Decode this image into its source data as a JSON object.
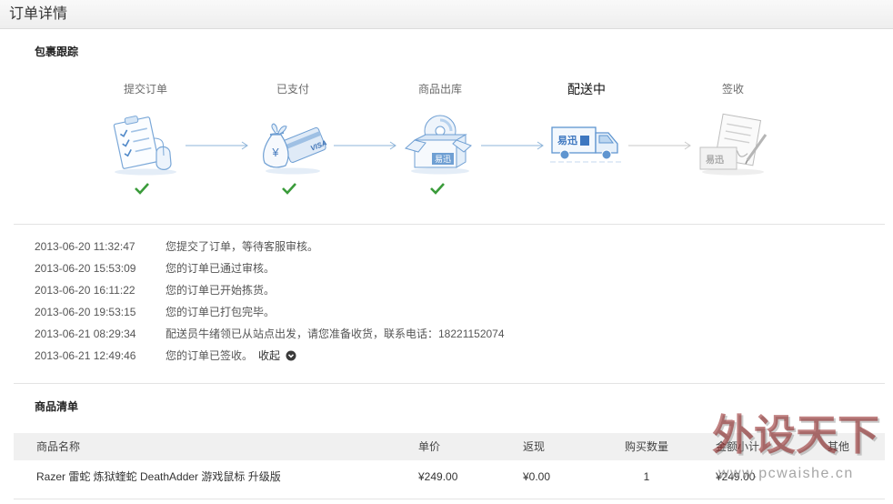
{
  "header": {
    "title": "订单详情"
  },
  "tracking": {
    "title": "包裹跟踪",
    "steps": [
      {
        "label": "提交订单",
        "icon": "order-clipboard-icon",
        "done": true,
        "current": false
      },
      {
        "label": "已支付",
        "icon": "payment-card-icon",
        "done": true,
        "current": false
      },
      {
        "label": "商品出库",
        "icon": "package-box-icon",
        "done": true,
        "current": false
      },
      {
        "label": "配送中",
        "icon": "delivery-truck-icon",
        "done": false,
        "current": true
      },
      {
        "label": "签收",
        "icon": "signed-document-icon",
        "done": false,
        "current": false
      }
    ],
    "icon_text": {
      "bag": "¥",
      "card": "VISA",
      "box": "易迅",
      "truck": "易迅",
      "sign": "易迅"
    },
    "log": [
      {
        "time": "2013-06-20 11:32:47",
        "message": "您提交了订单，等待客服审核。"
      },
      {
        "time": "2013-06-20 15:53:09",
        "message": "您的订单已通过审核。"
      },
      {
        "time": "2013-06-20 16:11:22",
        "message": "您的订单已开始拣货。"
      },
      {
        "time": "2013-06-20 19:53:15",
        "message": "您的订单已打包完毕。"
      },
      {
        "time": "2013-06-21 08:29:34",
        "message": "配送员牛绪领已从站点出发，请您准备收货，联系电话：18221152074"
      },
      {
        "time": "2013-06-21 12:49:46",
        "message": "您的订单已签收。"
      }
    ],
    "collapse_label": "收起",
    "collapse_icon": "chevron-down-circle-icon"
  },
  "products": {
    "title": "商品清单",
    "columns": {
      "name": "商品名称",
      "price": "单价",
      "cashback": "返现",
      "quantity": "购买数量",
      "subtotal": "金额小计",
      "other": "其他"
    },
    "rows": [
      {
        "name": "Razer 雷蛇 炼狱蝰蛇 DeathAdder 游戏鼠标 升级版",
        "price": "¥249.00",
        "cashback": "¥0.00",
        "quantity": "1",
        "subtotal": "¥249.00"
      }
    ]
  },
  "watermark": {
    "brand": "外设天下",
    "url": "www.pcwaishe.cn"
  },
  "colors": {
    "check": "#3a9b3a",
    "icon_blue": "#6f9fd3",
    "arrow": "#8db4d9",
    "inactive": "#bdbdbd",
    "watermark": "#8c1c1c"
  }
}
